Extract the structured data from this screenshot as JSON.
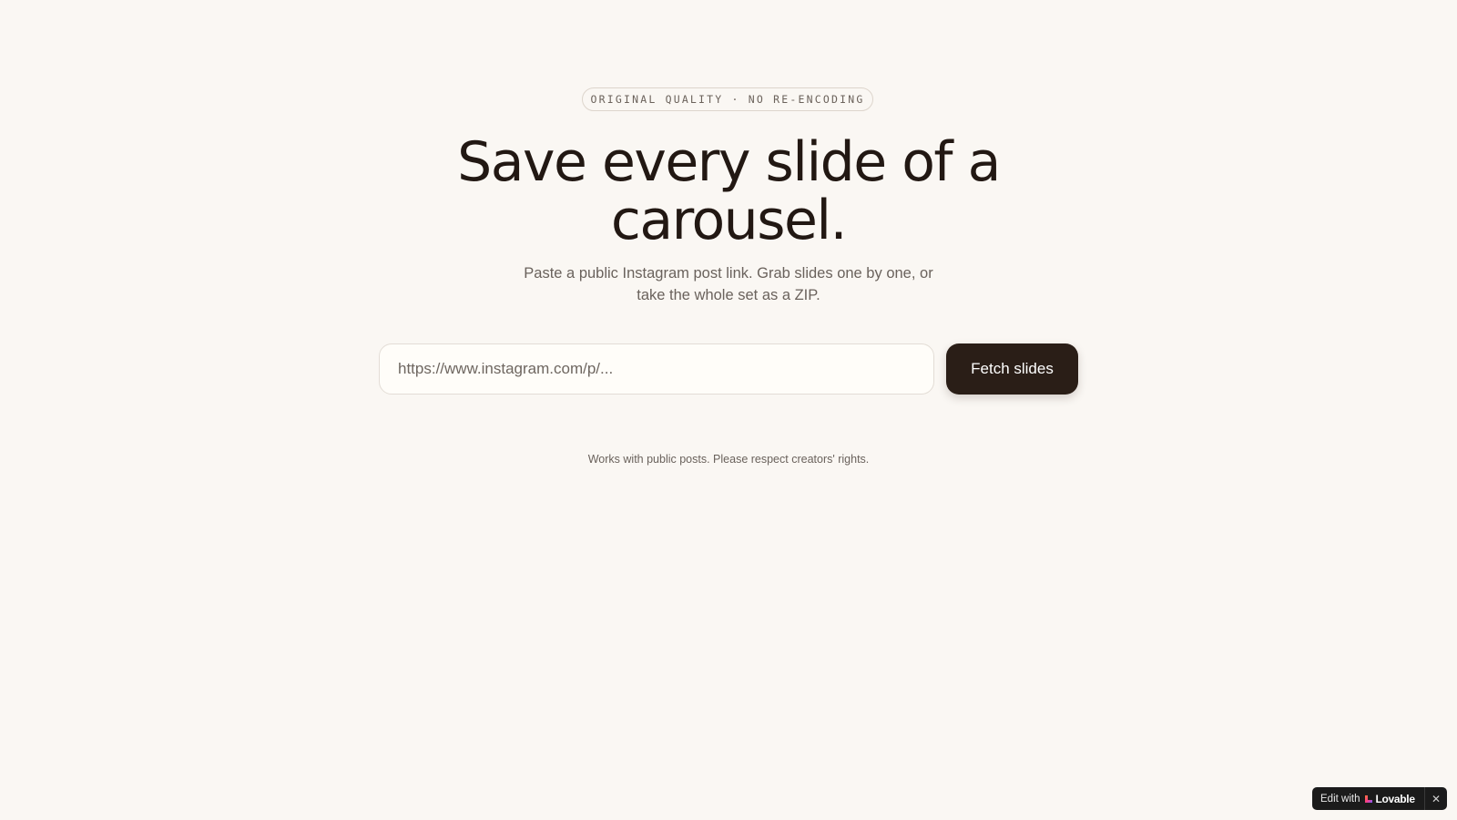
{
  "hero": {
    "badge": "ORIGINAL QUALITY · NO RE-ENCODING",
    "headline": "Save every slide of a carousel.",
    "subtitle": "Paste a public Instagram post link. Grab slides one by one, or take the whole set as a ZIP."
  },
  "form": {
    "url_placeholder": "https://www.instagram.com/p/...",
    "url_value": "",
    "submit_label": "Fetch slides"
  },
  "footnote": "Works with public posts. Please respect creators' rights.",
  "edit_badge": {
    "prefix": "Edit with",
    "brand": "Lovable",
    "close_glyph": "✕",
    "heart_icon": "lovable-heart-icon"
  },
  "colors": {
    "background": "#faf7f3",
    "text": "#221813",
    "button": "#2a1e17",
    "muted": "#6a625c"
  }
}
